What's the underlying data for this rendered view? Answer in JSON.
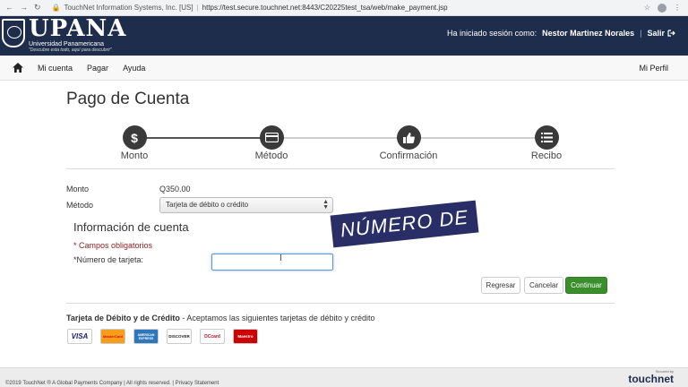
{
  "browser": {
    "site_label": "TouchNet Information Systems, Inc. [US]",
    "url": "https://test.secure.touchnet.net:8443/C20225test_tsa/web/make_payment.jsp"
  },
  "header": {
    "logo_text": "UPANA",
    "logo_subtitle": "Universidad Panamericana",
    "logo_tagline": "\"Descubre esta todo, aquí para descubrir\"",
    "session_label": "Ha iniciado sesión como:",
    "user_name": "Nestor Martinez Norales",
    "separator": "|",
    "logout_label": "Salir"
  },
  "navbar": {
    "items": [
      "Mi cuenta",
      "Pagar",
      "Ayuda"
    ],
    "profile": "Mi Perfil"
  },
  "page": {
    "title": "Pago de Cuenta"
  },
  "steps": [
    {
      "label": "Monto",
      "icon": "dollar-icon"
    },
    {
      "label": "Método",
      "icon": "credit-card-icon"
    },
    {
      "label": "Confirmación",
      "icon": "thumbs-up-icon"
    },
    {
      "label": "Recibo",
      "icon": "list-icon"
    }
  ],
  "form": {
    "amount_label": "Monto",
    "amount_value": "Q350.00",
    "method_label": "Método",
    "method_value": "Tarjeta de débito o crédito",
    "section_title": "Información de cuenta",
    "required_note": "* Campos obligatorios",
    "card_number_label": "*Número de tarjeta:",
    "card_number_value": ""
  },
  "overlay": {
    "banner_text": "NÚMERO DE"
  },
  "buttons": {
    "back": "Regresar",
    "cancel": "Cancelar",
    "continue": "Continuar"
  },
  "cards": {
    "title_bold": "Tarjeta de Débito y de Crédito",
    "title_rest": " - Aceptamos las siguientes tarjetas de débito y crédito",
    "logos": [
      "VISA",
      "MasterCard",
      "AMERICAN EXPRESS",
      "DISCOVER",
      "DCcard",
      "Maestro"
    ]
  },
  "footer": {
    "copyright": "©2019 TouchNet ® A Global Payments Company | All rights reserved. | Privacy Statement",
    "secured_by": "Secured by",
    "brand": "touchnet"
  },
  "colors": {
    "header_bg": "#1f2d4d",
    "primary_button": "#3a8e2c",
    "required": "#8b1c1c"
  }
}
